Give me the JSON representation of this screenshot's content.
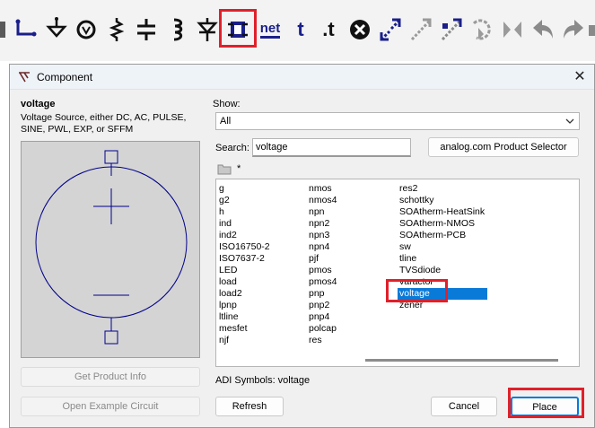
{
  "toolbar": {
    "tools": [
      {
        "icon": "wire-icon"
      },
      {
        "icon": "ground-icon"
      },
      {
        "icon": "voltage-source-icon"
      },
      {
        "icon": "resistor-icon"
      },
      {
        "icon": "capacitor-icon"
      },
      {
        "icon": "inductor-icon"
      },
      {
        "icon": "diode-icon"
      },
      {
        "icon": "component-icon"
      },
      {
        "icon": "net-label-icon",
        "label": "net"
      },
      {
        "icon": "text-icon",
        "label": "t"
      },
      {
        "icon": "spice-directive-icon",
        "label": ".t"
      },
      {
        "icon": "delete-icon"
      },
      {
        "icon": "duplicate-icon"
      },
      {
        "icon": "move-icon"
      },
      {
        "icon": "drag-icon"
      },
      {
        "icon": "rotate-icon"
      },
      {
        "icon": "mirror-icon"
      },
      {
        "icon": "undo-icon"
      },
      {
        "icon": "redo-icon"
      }
    ]
  },
  "dialog": {
    "title": "Component",
    "component_name": "voltage",
    "component_desc": "Voltage Source, either DC, AC, PULSE, SINE, PWL, EXP, or SFFM",
    "show_label": "Show:",
    "show_value": "All",
    "search_label": "Search:",
    "search_value": "voltage",
    "product_selector": "analog.com Product Selector",
    "folder_path": "*",
    "list": {
      "col1": [
        "g",
        "g2",
        "h",
        "ind",
        "ind2",
        "ISO16750-2",
        "ISO7637-2",
        "LED",
        "load",
        "load2",
        "lpnp",
        "ltline",
        "mesfet",
        "njf"
      ],
      "col2": [
        "nmos",
        "nmos4",
        "npn",
        "npn2",
        "npn3",
        "npn4",
        "pjf",
        "pmos",
        "pmos4",
        "pnp",
        "pnp2",
        "pnp4",
        "polcap",
        "res"
      ],
      "col3": [
        "res2",
        "schottky",
        "SOAtherm-HeatSink",
        "SOAtherm-NMOS",
        "SOAtherm-PCB",
        "sw",
        "tline",
        "TVSdiode",
        "varactor",
        "voltage",
        "zener"
      ],
      "selected": "voltage"
    },
    "adi_symbols": "ADI Symbols: voltage",
    "buttons": {
      "get_info": "Get Product Info",
      "example": "Open Example Circuit",
      "refresh": "Refresh",
      "cancel": "Cancel",
      "place": "Place"
    }
  },
  "colors": {
    "toolbar_icon": "#1a1f8a",
    "highlight": "#e0202a",
    "selection": "#0a7ad8",
    "symbol_line": "#00008b"
  }
}
